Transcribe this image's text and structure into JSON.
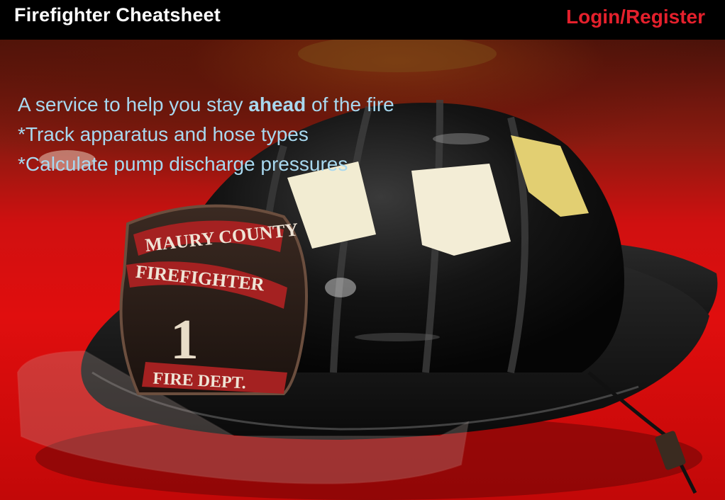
{
  "header": {
    "brand": "Firefighter Cheatsheet",
    "login_label": "Login/Register"
  },
  "hero": {
    "tagline_prefix": "A service to help you stay ",
    "tagline_emphasis": "ahead",
    "tagline_suffix": " of the fire",
    "features": [
      "*Track apparatus and hose types",
      "*Calculate pump discharge pressures"
    ],
    "helmet_shield": {
      "line1": "MAURY COUNTY",
      "line2": "FIREFIGHTER",
      "number": "1",
      "line3": "FIRE DEPT."
    }
  },
  "colors": {
    "header_bg": "#000000",
    "brand_text": "#ffffff",
    "login_text": "#e4202c",
    "tagline_text": "#a8d8ef",
    "background_red": "#d81010"
  }
}
